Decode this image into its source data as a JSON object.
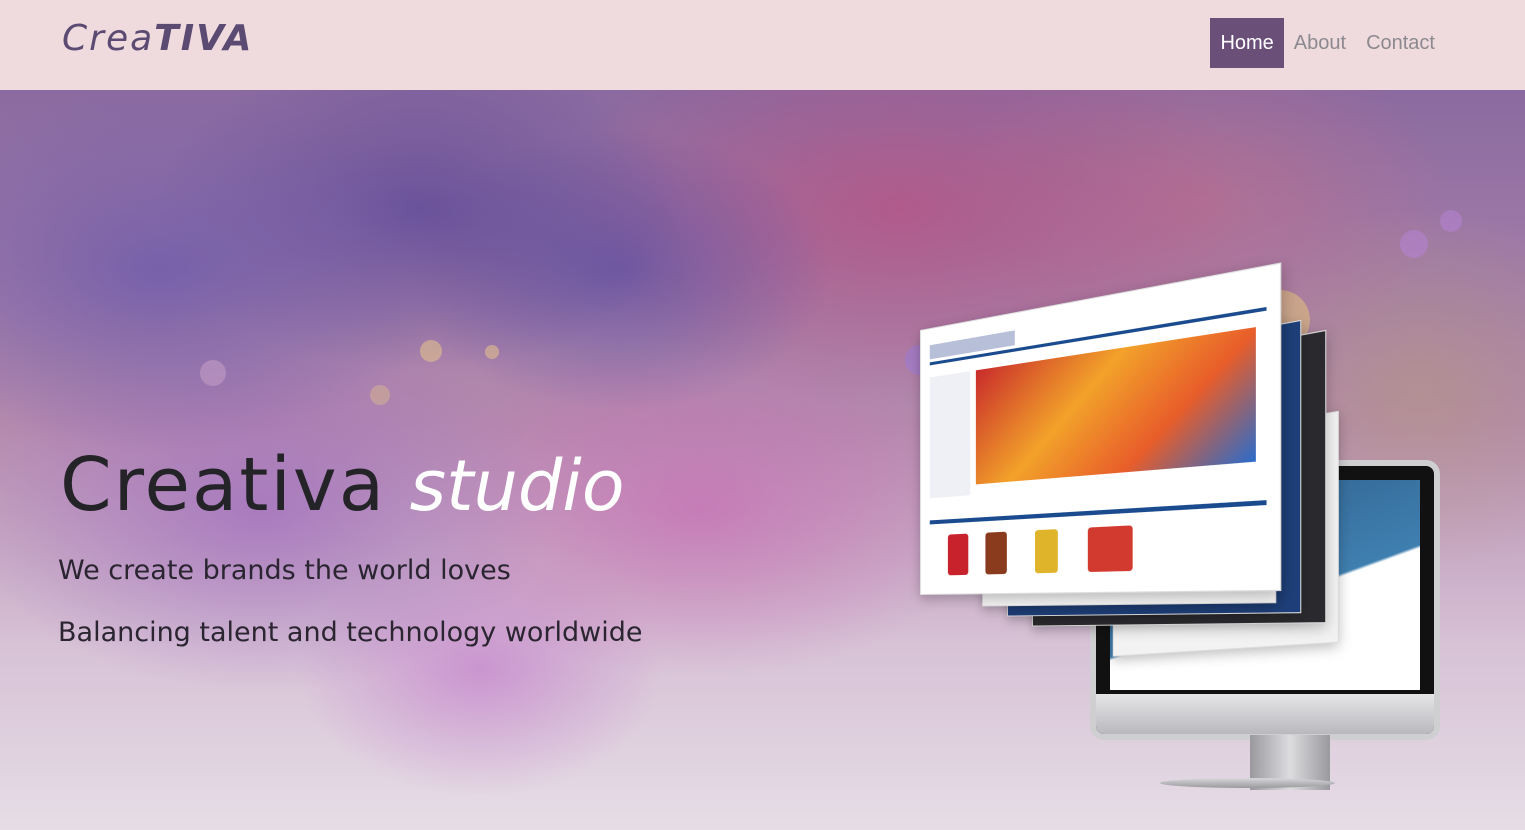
{
  "navbar": {
    "brand_light": "Crea",
    "brand_bold": "TIVA",
    "links": [
      "Home",
      "About",
      "Contact"
    ],
    "active": "Home"
  },
  "hero": {
    "title_main": "Creativa",
    "title_accent": "studio",
    "tagline_1": "We create brands the world loves",
    "tagline_2": "Balancing talent and technology worldwide"
  },
  "illustration": {
    "icons": [
      "website-pages-icon",
      "desktop-monitor-icon"
    ]
  },
  "colors": {
    "navbar_bg": "#efdade",
    "brand": "#5b4a72",
    "active_link_bg": "#6a4f79",
    "link": "#8c8a8f"
  }
}
